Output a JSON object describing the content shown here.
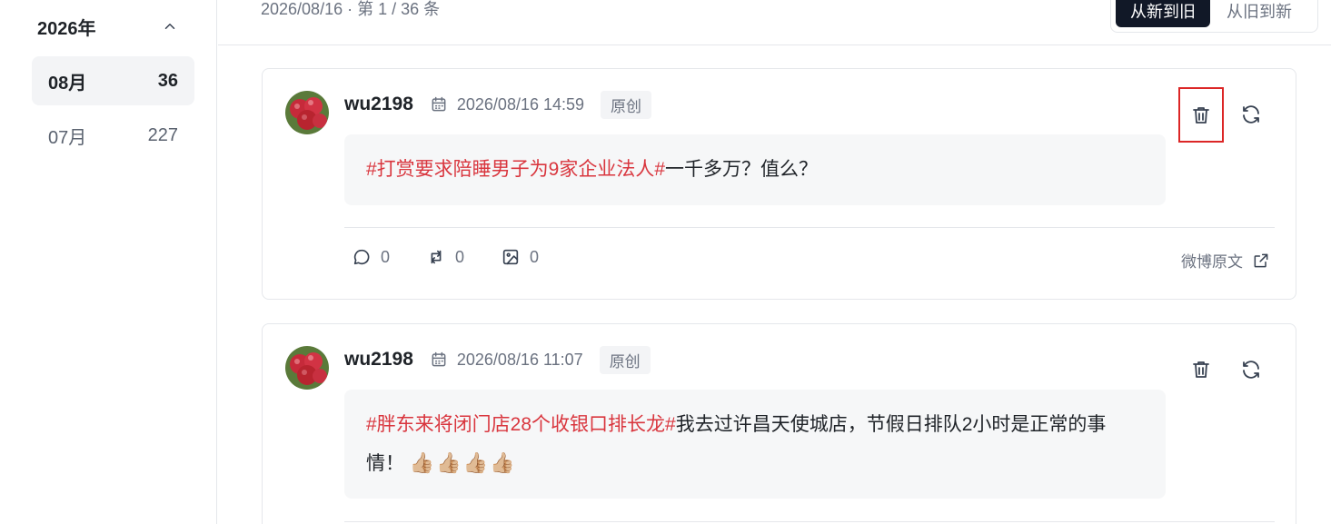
{
  "sidebar": {
    "year": "2026年",
    "months": [
      {
        "label": "08月",
        "count": "36",
        "active": true
      },
      {
        "label": "07月",
        "count": "227",
        "active": false
      }
    ]
  },
  "header": {
    "summary": "2026/08/16 · 第 1 / 36 条",
    "sort_new_to_old": "从新到旧",
    "sort_old_to_new": "从旧到新"
  },
  "posts": [
    {
      "username": "wu2198",
      "datetime": "2026/08/16 14:59",
      "badge": "原创",
      "tag": "#打赏要求陪睡男子为9家企业法人#",
      "text": "一千多万？值么？",
      "comments": "0",
      "reposts": "0",
      "images": "0",
      "origin_link": "微博原文"
    },
    {
      "username": "wu2198",
      "datetime": "2026/08/16 11:07",
      "badge": "原创",
      "tag": "#胖东来将闭门店28个收银口排长龙#",
      "text": "我去过许昌天使城店，节假日排队2小时是正常的事情！",
      "emoji": "👍🏼👍🏼👍🏼👍🏼"
    }
  ],
  "icons": [
    "chevron-up-icon",
    "calendar-icon",
    "trash-icon",
    "refresh-icon",
    "comment-icon",
    "repost-icon",
    "image-icon",
    "external-link-icon"
  ],
  "colors": {
    "accent_tag": "#d9363e",
    "highlight_border": "#dc2626",
    "active_sort_bg": "#111827"
  }
}
